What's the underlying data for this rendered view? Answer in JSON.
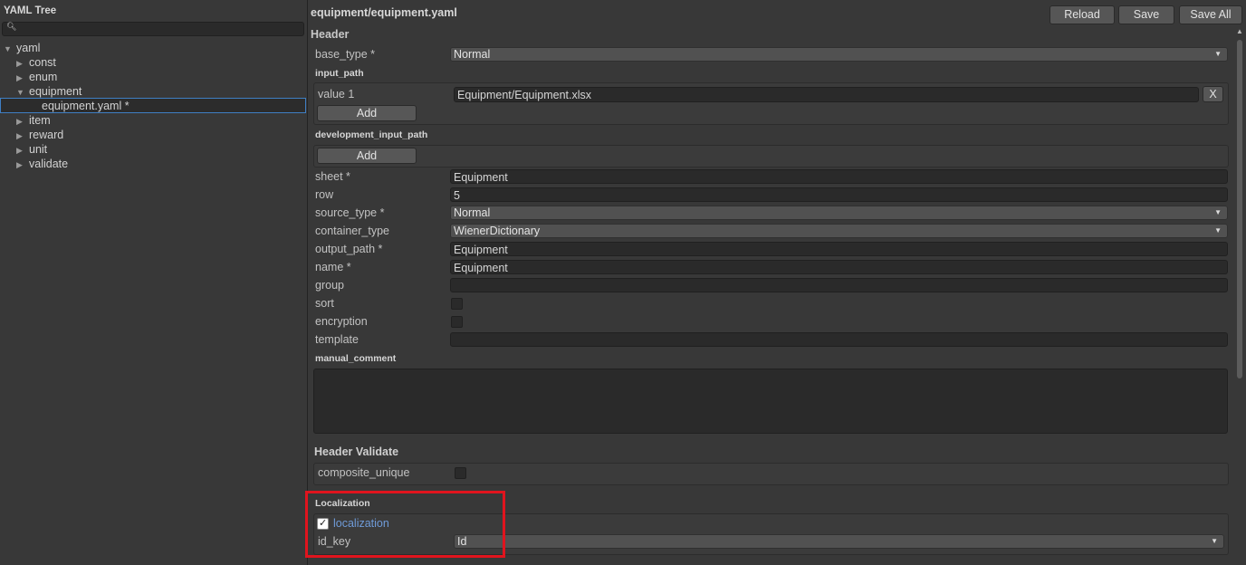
{
  "tree": {
    "title": "YAML Tree",
    "search_placeholder": "",
    "items": [
      {
        "label": "yaml",
        "expanded": true
      },
      {
        "label": "const",
        "expanded": false
      },
      {
        "label": "enum",
        "expanded": false
      },
      {
        "label": "equipment",
        "expanded": true
      },
      {
        "label": "equipment.yaml *",
        "selected": true
      },
      {
        "label": "item",
        "expanded": false
      },
      {
        "label": "reward",
        "expanded": false
      },
      {
        "label": "unit",
        "expanded": false
      },
      {
        "label": "validate",
        "expanded": false
      }
    ]
  },
  "editor": {
    "file_title": "equipment/equipment.yaml",
    "toolbar": {
      "reload": "Reload",
      "save": "Save",
      "save_all": "Save All"
    },
    "header_section": "Header",
    "base_type": {
      "label": "base_type *",
      "value": "Normal"
    },
    "input_path": {
      "label": "input_path",
      "item_label": "value 1",
      "item_value": "Equipment/Equipment.xlsx",
      "remove": "X",
      "add": "Add"
    },
    "development_input_path": {
      "label": "development_input_path",
      "add": "Add"
    },
    "sheet": {
      "label": "sheet *",
      "value": "Equipment"
    },
    "row": {
      "label": "row",
      "value": "5"
    },
    "source_type": {
      "label": "source_type *",
      "value": "Normal"
    },
    "container_type": {
      "label": "container_type",
      "value": "WienerDictionary"
    },
    "output_path": {
      "label": "output_path *",
      "value": "Equipment"
    },
    "name": {
      "label": "name *",
      "value": "Equipment"
    },
    "group": {
      "label": "group",
      "value": ""
    },
    "sort": {
      "label": "sort",
      "checked": false
    },
    "encryption": {
      "label": "encryption",
      "checked": false
    },
    "template": {
      "label": "template",
      "value": ""
    },
    "manual_comment": {
      "label": "manual_comment",
      "value": ""
    },
    "header_validate": {
      "title": "Header Validate",
      "composite_unique": {
        "label": "composite_unique",
        "checked": false
      }
    },
    "localization": {
      "title": "Localization",
      "toggle_label": "localization",
      "toggle_checked": true,
      "id_key": {
        "label": "id_key",
        "value": "Id"
      }
    }
  },
  "colors": {
    "highlight": "#e0141e",
    "selection": "#3f7fc4",
    "link_blue": "#6f9bd8"
  }
}
